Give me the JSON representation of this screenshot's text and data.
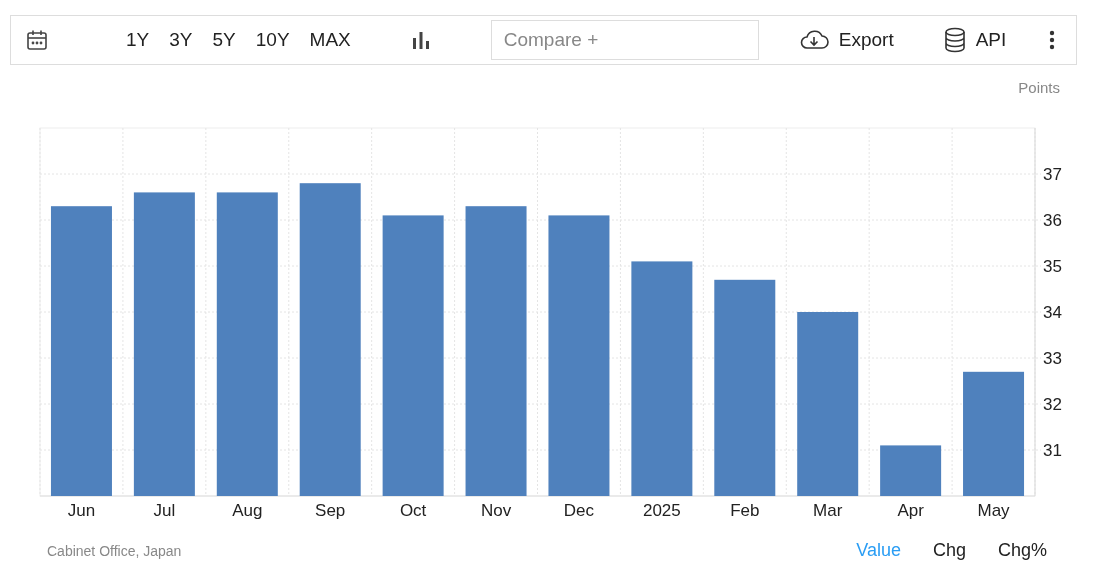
{
  "toolbar": {
    "ranges": [
      {
        "label": "1Y"
      },
      {
        "label": "3Y"
      },
      {
        "label": "5Y"
      },
      {
        "label": "10Y"
      },
      {
        "label": "MAX"
      }
    ],
    "compare": {
      "placeholder": "Compare +"
    },
    "export": "Export",
    "api": "API"
  },
  "chart": {
    "unit": "Points",
    "chart_data": {
      "type": "bar",
      "categories": [
        "Jun",
        "Jul",
        "Aug",
        "Sep",
        "Oct",
        "Nov",
        "Dec",
        "2025",
        "Feb",
        "Mar",
        "Apr",
        "May"
      ],
      "series": [
        {
          "color": "#4f81bd",
          "values": [
            36.3,
            36.6,
            36.6,
            36.8,
            36.1,
            36.3,
            36.1,
            35.1,
            34.7,
            34.0,
            31.1,
            32.7
          ]
        }
      ],
      "grid": true,
      "ylim": [
        30,
        38
      ],
      "yticks": [
        31,
        32,
        33,
        34,
        35,
        36,
        37
      ]
    }
  },
  "footer": {
    "source": "Cabinet Office, Japan",
    "views": [
      {
        "label": "Value",
        "selected": true
      },
      {
        "label": "Chg",
        "selected": false
      },
      {
        "label": "Chg%",
        "selected": false
      }
    ]
  }
}
